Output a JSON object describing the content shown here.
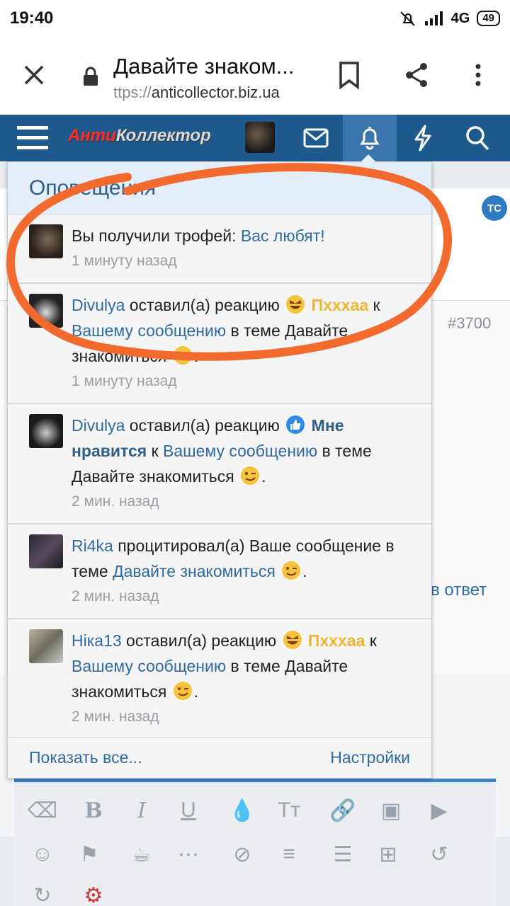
{
  "status_bar": {
    "time": "19:40",
    "network": "4G",
    "battery": "49"
  },
  "browser": {
    "title": "Давайте знаком...",
    "url_dim": "ttps://",
    "url_host": "anticollector.biz.ua"
  },
  "site": {
    "logo_red": "Анти",
    "logo_rest": "Коллектор"
  },
  "notifications": {
    "title": "Оповещения",
    "items": [
      {
        "text": "Вы получили трофей: ",
        "link": "Вас любят!",
        "time": "1 минуту назад"
      },
      {
        "user": "Divulya",
        "action": " оставил(а) реакцию ",
        "reaction": "Пхххаа",
        "to": " к ",
        "link": "Вашему сообщению",
        "in": " в теме Давайте знакомиться ",
        "time": "1 минуту назад"
      },
      {
        "user": "Divulya",
        "action": " оставил(а) реакцию ",
        "reaction": "Мне нравится",
        "to": " к ",
        "link": "Вашему сообщению",
        "in": " в теме Давайте знакомиться ",
        "time": "2 мин. назад"
      },
      {
        "user": "Ri4ka",
        "action": " процитировал(а) Ваше сообщение в теме ",
        "link": "Давайте знакомиться",
        "time": "2 мин. назад"
      },
      {
        "user": "Ніка13",
        "action": " оставил(а) реакцию ",
        "reaction": "Пхххаа",
        "to": " к ",
        "link": "Вашему сообщению",
        "in": " в теме Давайте знакомиться ",
        "time": "2 мин. назад"
      }
    ],
    "footer": {
      "show_all": "Показать все...",
      "settings": "Настройки"
    }
  },
  "background": {
    "post_number": "#3700",
    "reply_text": "в ответ",
    "avatar_initials": "TC"
  },
  "colors": {
    "header": "#1f5a8e",
    "link": "#2f6aa3",
    "annotation": "#f26a2e",
    "reaction_gold": "#f2b52e"
  }
}
